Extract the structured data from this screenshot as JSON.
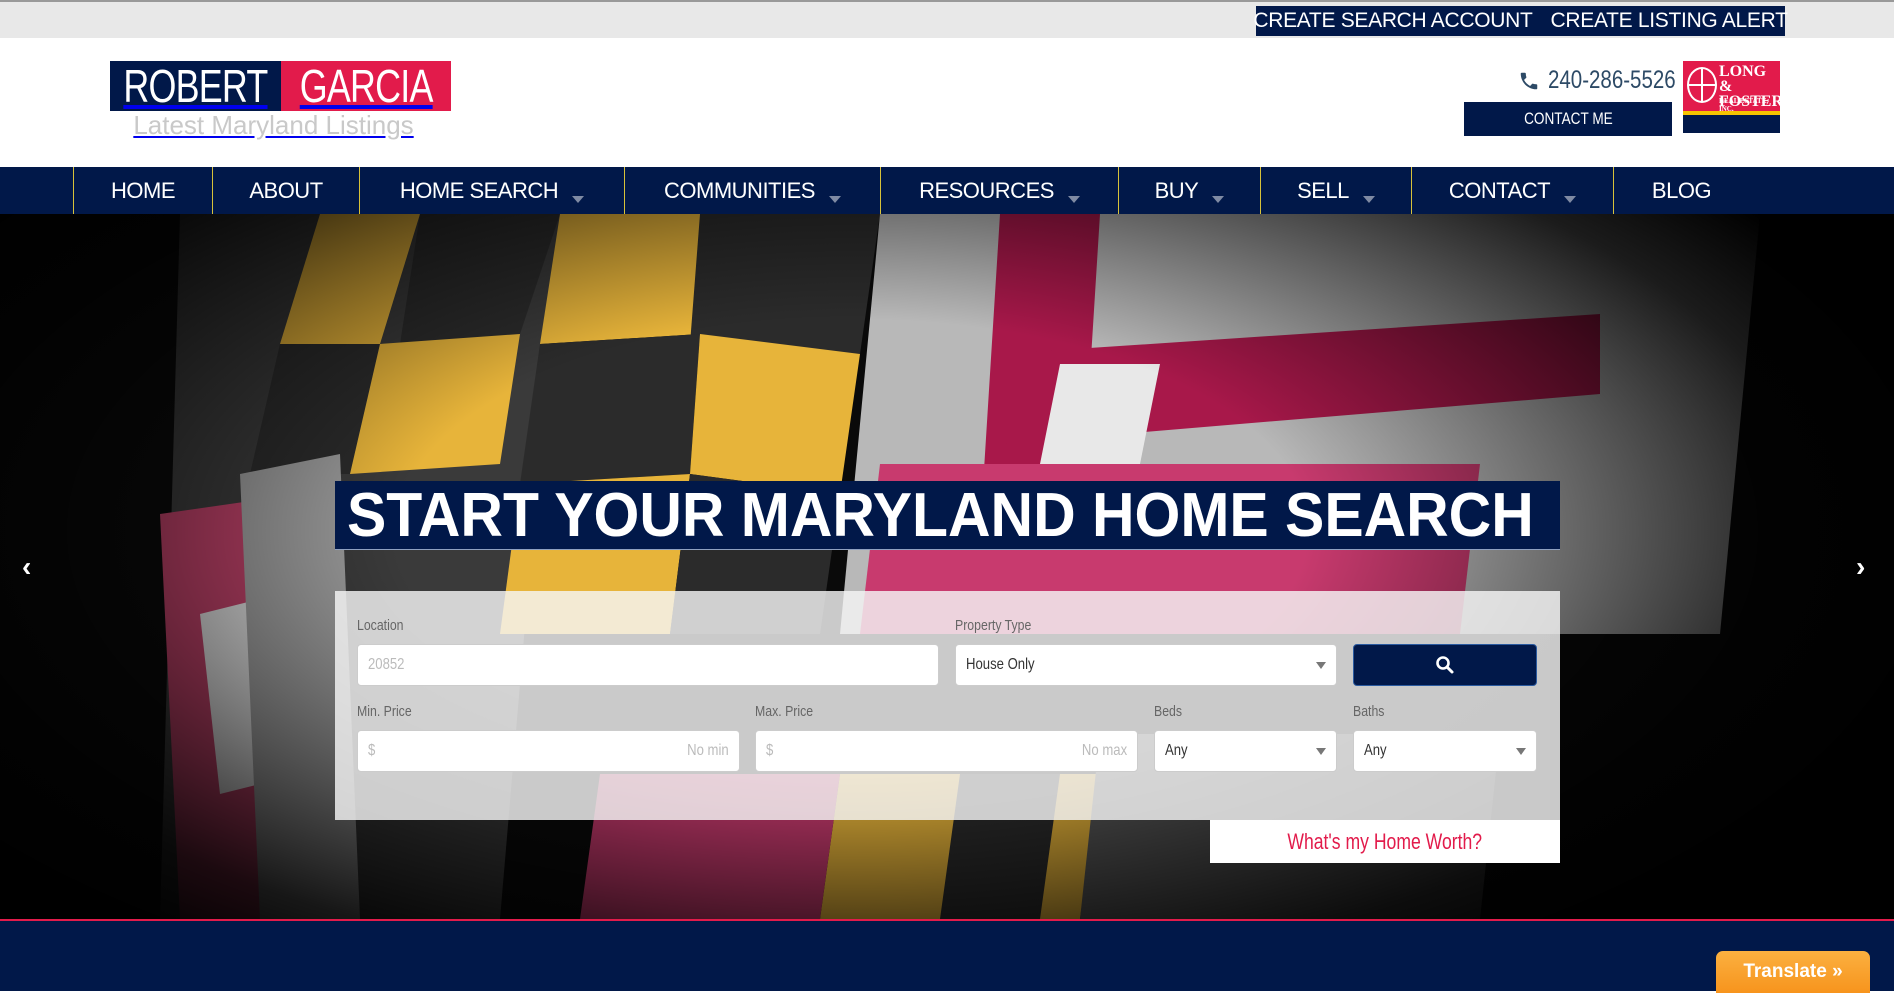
{
  "topbar": {
    "links": [
      {
        "label": "CREATE SEARCH ACCOUNT"
      },
      {
        "label": "CREATE LISTING ALERT"
      }
    ]
  },
  "header": {
    "logo": {
      "first_name": "ROBERT",
      "last_name": "GARCIA",
      "tagline": "Latest Maryland Listings"
    },
    "phone": "240-286-5526",
    "contact_button": "CONTACT ME",
    "brokerage_logo": {
      "line1": "LONG &",
      "line2": "FOSTER",
      "line3": "REAL ESTATE, INC."
    }
  },
  "nav": {
    "items": [
      {
        "label": "HOME",
        "has_dropdown": false
      },
      {
        "label": "ABOUT",
        "has_dropdown": false
      },
      {
        "label": "HOME SEARCH",
        "has_dropdown": true
      },
      {
        "label": "COMMUNITIES",
        "has_dropdown": true
      },
      {
        "label": "RESOURCES",
        "has_dropdown": true
      },
      {
        "label": "BUY",
        "has_dropdown": true
      },
      {
        "label": "SELL",
        "has_dropdown": true
      },
      {
        "label": "CONTACT",
        "has_dropdown": true
      },
      {
        "label": "BLOG",
        "has_dropdown": false
      }
    ]
  },
  "hero": {
    "title": "START YOUR MARYLAND HOME SEARCH",
    "prev_arrow": "‹",
    "next_arrow": "›",
    "form": {
      "location": {
        "label": "Location",
        "placeholder": "20852",
        "value": ""
      },
      "property_type": {
        "label": "Property Type",
        "value": "House Only"
      },
      "min_price": {
        "label": "Min. Price",
        "prefix": "$",
        "placeholder": "No min"
      },
      "max_price": {
        "label": "Max. Price",
        "prefix": "$",
        "placeholder": "No max"
      },
      "beds": {
        "label": "Beds",
        "value": "Any"
      },
      "baths": {
        "label": "Baths",
        "value": "Any"
      },
      "search_icon": "search-icon"
    },
    "home_worth_link": "What's my Home Worth?"
  },
  "translate_button": "Translate »",
  "colors": {
    "navy": "#011849",
    "red": "#e21b4b",
    "nav_separator": "#d7c23a",
    "translate_orange": "#f7941d"
  }
}
